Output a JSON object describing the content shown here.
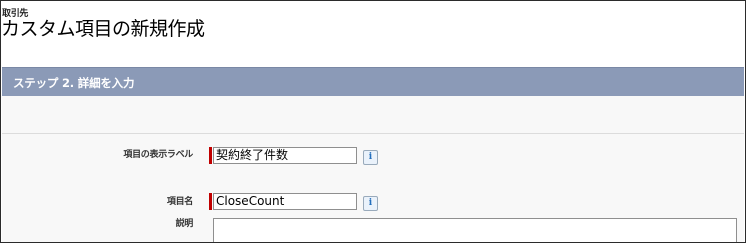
{
  "header": {
    "breadcrumb": "取引先",
    "title": "カスタム項目の新規作成"
  },
  "step": {
    "title": "ステップ 2. 詳細を入力"
  },
  "form": {
    "fields": [
      {
        "label": "項目の表示ラベル",
        "value": "契約終了件数",
        "required": true,
        "info_icon": "i"
      },
      {
        "label": "項目名",
        "value": "CloseCount",
        "required": true,
        "info_icon": "i"
      },
      {
        "label": "説明",
        "value": ""
      }
    ]
  },
  "colors": {
    "step_header_bg": "#8b9ab7",
    "required_marker": "#c00000"
  }
}
